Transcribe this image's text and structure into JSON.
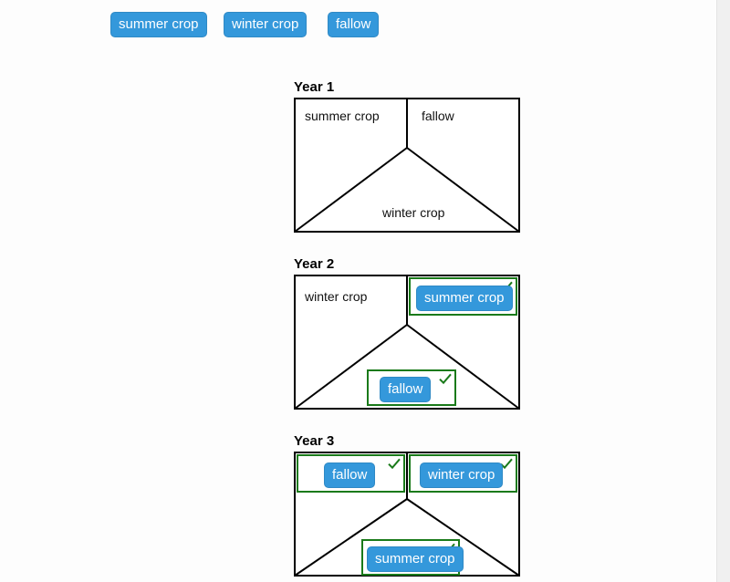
{
  "palette": {
    "summer": "summer crop",
    "winter": "winter crop",
    "fallow": "fallow"
  },
  "years": {
    "y1": {
      "label": "Year 1",
      "tl": "summer crop",
      "tr": "fallow",
      "bottom": "winter crop"
    },
    "y2": {
      "label": "Year 2",
      "tl": "winter crop",
      "tr_pill": "summer crop",
      "bottom_pill": "fallow"
    },
    "y3": {
      "label": "Year 3",
      "tl_pill": "fallow",
      "tr_pill": "winter crop",
      "bottom_pill": "summer crop"
    }
  }
}
